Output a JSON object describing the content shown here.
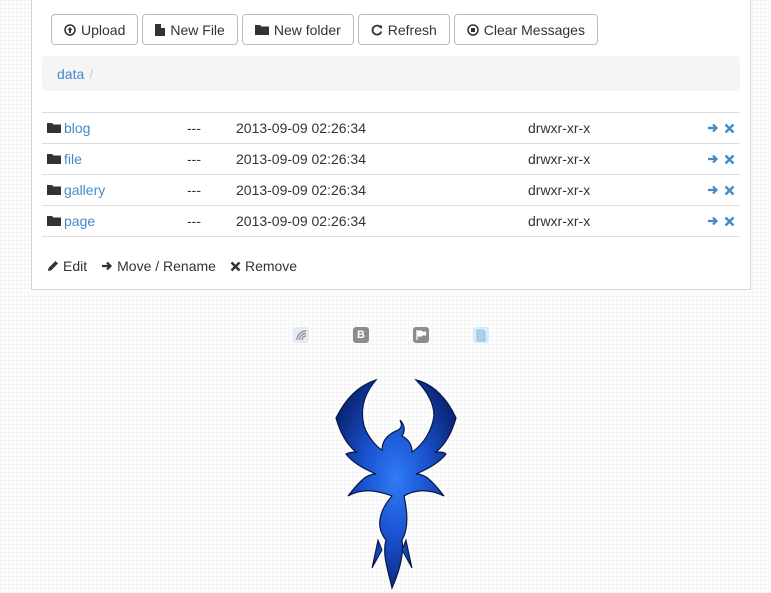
{
  "toolbar": {
    "upload": "Upload",
    "new_file": "New File",
    "new_folder": "New folder",
    "refresh": "Refresh",
    "clear_messages": "Clear Messages"
  },
  "breadcrumb": {
    "items": [
      "data"
    ],
    "separator": "/"
  },
  "files": [
    {
      "name": "blog",
      "size": "---",
      "modified": "2013-09-09 02:26:34",
      "permissions": "drwxr-xr-x"
    },
    {
      "name": "file",
      "size": "---",
      "modified": "2013-09-09 02:26:34",
      "permissions": "drwxr-xr-x"
    },
    {
      "name": "gallery",
      "size": "---",
      "modified": "2013-09-09 02:26:34",
      "permissions": "drwxr-xr-x"
    },
    {
      "name": "page",
      "size": "---",
      "modified": "2013-09-09 02:26:34",
      "permissions": "drwxr-xr-x"
    }
  ],
  "bottom_actions": {
    "edit": "Edit",
    "move_rename": "Move / Rename",
    "remove": "Remove"
  },
  "footer_logos": [
    {
      "icon": "feed-logo-icon",
      "color": "#9aa4b0"
    },
    {
      "icon": "bootstrap-logo-icon",
      "color": "#8c8c8c",
      "text": "B"
    },
    {
      "icon": "flag-logo-icon",
      "color": "#8c8c8c"
    },
    {
      "icon": "document-logo-icon",
      "color": "#a9d3ec"
    }
  ],
  "colors": {
    "link": "#428bca",
    "phoenix_blue": "#1b5ad8"
  }
}
